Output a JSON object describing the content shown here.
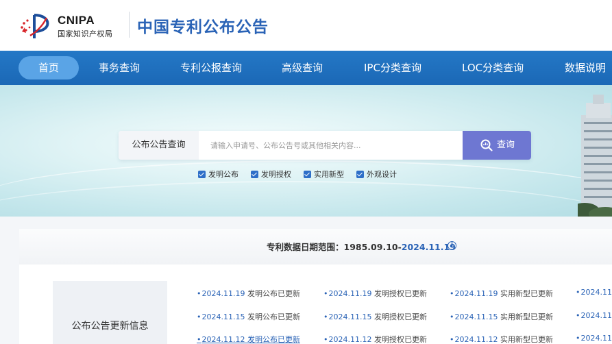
{
  "logo": {
    "abbr": "CNIPA",
    "org": "国家知识产权局"
  },
  "site_title": "中国专利公布公告",
  "nav": {
    "home": "首页",
    "items": [
      "事务查询",
      "专利公报查询",
      "高级查询",
      "IPC分类查询",
      "LOC分类查询",
      "数据说明"
    ]
  },
  "search": {
    "label": "公布公告查询",
    "placeholder": "请输入申请号、公布公告号或其他相关内容...",
    "value": "",
    "button": "查询",
    "checks": [
      {
        "label": "发明公布",
        "checked": true
      },
      {
        "label": "发明授权",
        "checked": true
      },
      {
        "label": "实用新型",
        "checked": true
      },
      {
        "label": "外观设计",
        "checked": true
      }
    ]
  },
  "range": {
    "label": "专利数据日期范围：",
    "start": "1985.09.10-",
    "end": "2024.11.19",
    "info_icon": "info-icon"
  },
  "updates": {
    "title": "公布公告更新信息",
    "rows": [
      [
        {
          "date": "2024.11.19",
          "text": "发明公布已更新"
        },
        {
          "date": "2024.11.19",
          "text": "发明授权已更新"
        },
        {
          "date": "2024.11.19",
          "text": "实用新型已更新"
        },
        {
          "date": "2024.11",
          "text": ""
        }
      ],
      [
        {
          "date": "2024.11.15",
          "text": "发明公布已更新"
        },
        {
          "date": "2024.11.15",
          "text": "发明授权已更新"
        },
        {
          "date": "2024.11.15",
          "text": "实用新型已更新"
        },
        {
          "date": "2024.11",
          "text": ""
        }
      ],
      [
        {
          "date": "2024.11.12",
          "text": "发明公布已更新"
        },
        {
          "date": "2024.11.12",
          "text": "发明授权已更新"
        },
        {
          "date": "2024.11.12",
          "text": "实用新型已更新"
        },
        {
          "date": "2024.11",
          "text": ""
        }
      ]
    ]
  },
  "colors": {
    "brand": "#2a63b6",
    "nav": "#1f6fbd",
    "search_button": "#6e77d2",
    "home_pill": "#5aa4e6"
  }
}
